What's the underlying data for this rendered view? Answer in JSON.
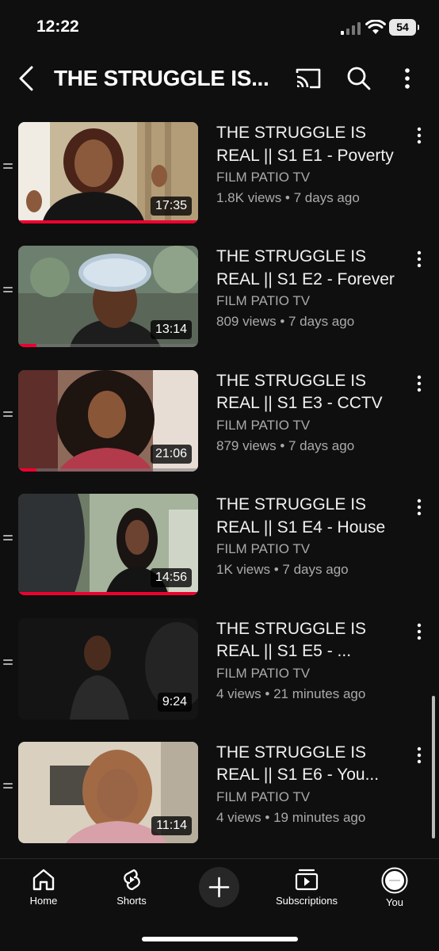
{
  "status": {
    "time": "12:22",
    "battery": "54"
  },
  "header": {
    "title": "THE STRUGGLE IS...",
    "back_icon": "chevron-left-icon",
    "cast_icon": "cast-icon",
    "search_icon": "search-icon",
    "more_icon": "more-vertical-icon"
  },
  "videos": [
    {
      "title": "THE STRUGGLE IS REAL || S1 E1 - Poverty",
      "channel": "FILM PATIO TV",
      "meta": "1.8K views • 7 days ago",
      "duration": "17:35",
      "watched": 1.0
    },
    {
      "title": "THE STRUGGLE IS REAL || S1 E2 - Forever",
      "channel": "FILM PATIO TV",
      "meta": "809 views • 7 days ago",
      "duration": "13:14",
      "watched": 0.1
    },
    {
      "title": "THE STRUGGLE IS REAL || S1 E3 - CCTV",
      "channel": "FILM PATIO TV",
      "meta": "879 views • 7 days ago",
      "duration": "21:06",
      "watched": 0.1
    },
    {
      "title": "THE STRUGGLE IS REAL || S1 E4 - House",
      "channel": "FILM PATIO TV",
      "meta": "1K views • 7 days ago",
      "duration": "14:56",
      "watched": 1.0
    },
    {
      "title": "THE STRUGGLE IS REAL || S1 E5 - ...",
      "channel": "FILM PATIO TV",
      "meta": "4 views • 21 minutes ago",
      "duration": "9:24",
      "watched": 0
    },
    {
      "title": "THE STRUGGLE IS REAL || S1 E6 - You...",
      "channel": "FILM PATIO TV",
      "meta": "4 views • 19 minutes ago",
      "duration": "11:14",
      "watched": 0
    }
  ],
  "nav": {
    "home": "Home",
    "shorts": "Shorts",
    "subscriptions": "Subscriptions",
    "you": "You"
  },
  "colors": {
    "background": "#0f0f0f",
    "progress": "#f00030",
    "secondary_text": "#aaaaaa"
  }
}
